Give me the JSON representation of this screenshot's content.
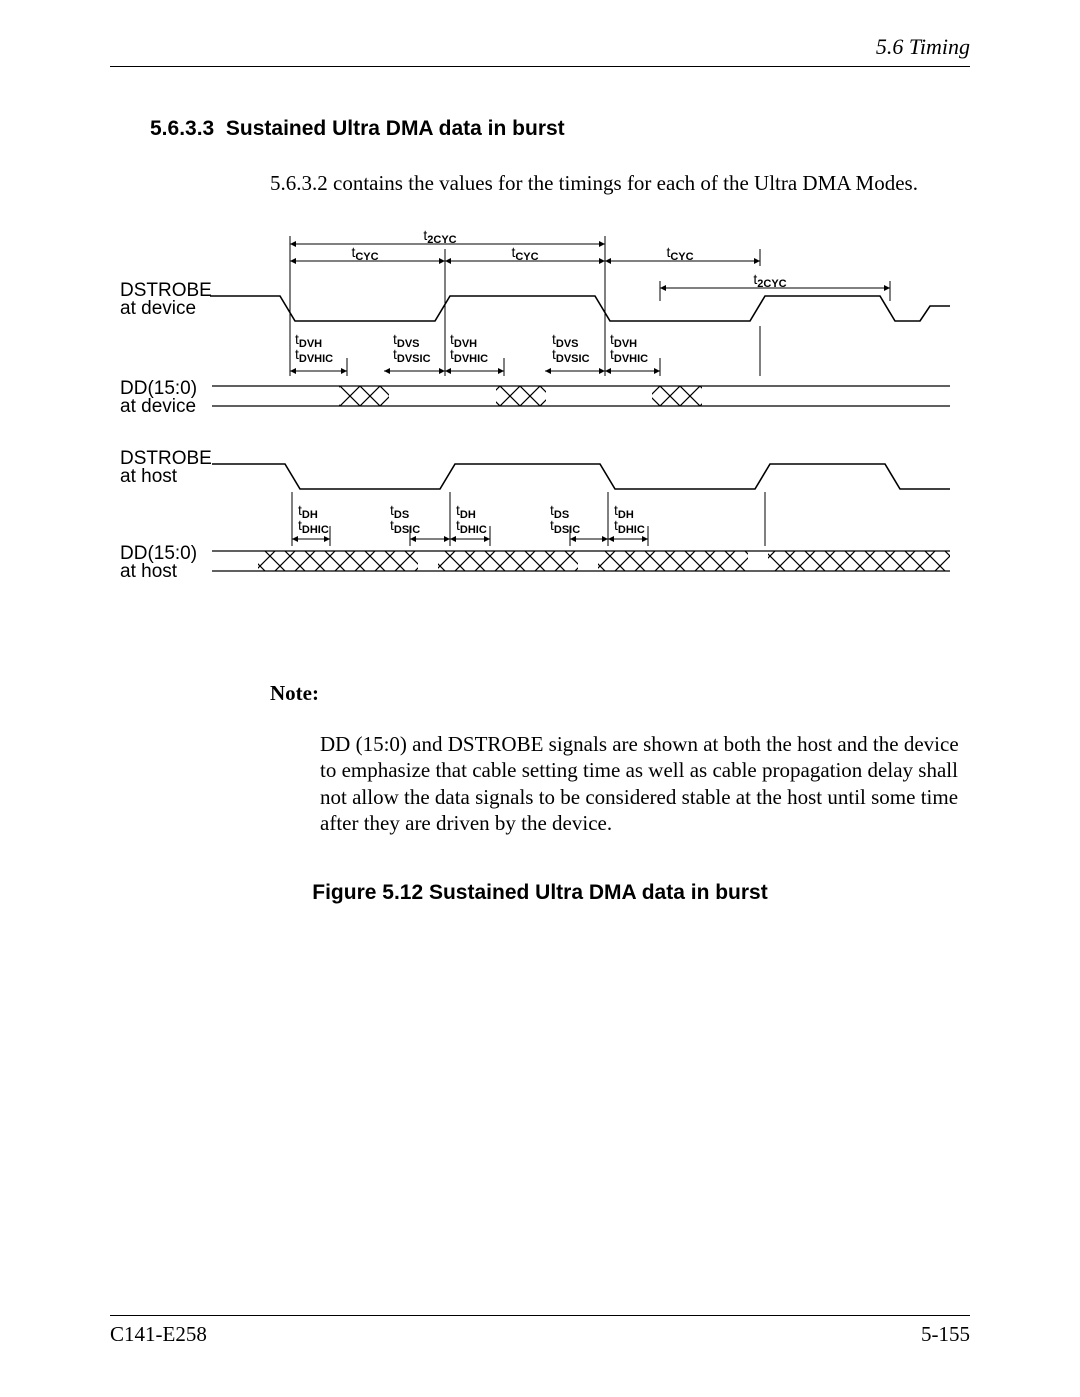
{
  "header": {
    "right": "5.6  Timing"
  },
  "section": {
    "number": "5.6.3.3",
    "title": "Sustained Ultra DMA data in burst"
  },
  "intro": "5.6.3.2 contains the values for the timings for each of the Ultra DMA Modes.",
  "diagram": {
    "signals": {
      "dstrobe_dev_l1": "DSTROBE",
      "dstrobe_dev_l2": "at device",
      "dd_dev_l1": "DD(15:0)",
      "dd_dev_l2": "at device",
      "dstrobe_host_l1": "DSTROBE",
      "dstrobe_host_l2": "at host",
      "dd_host_l1": "DD(15:0)",
      "dd_host_l2": "at host"
    },
    "timing_labels": {
      "t2cyc": "2CYC",
      "tcyc": "CYC",
      "tdvh": "DVH",
      "tdvhic": "DVHIC",
      "tdvs": "DVS",
      "tdvsic": "DVSIC",
      "tdh": "DH",
      "tdhic": "DHIC",
      "tds": "DS",
      "tdsic": "DSIC"
    }
  },
  "note": {
    "label": "Note:",
    "body": "DD (15:0) and DSTROBE signals are shown at both the host and the device to emphasize that cable setting time as well as cable propagation delay shall not allow the data signals to be considered stable at the host until some time after they are driven by the device."
  },
  "figure_caption": "Figure 5.12  Sustained Ultra DMA data in burst",
  "footer": {
    "left": "C141-E258",
    "right": "5-155"
  }
}
